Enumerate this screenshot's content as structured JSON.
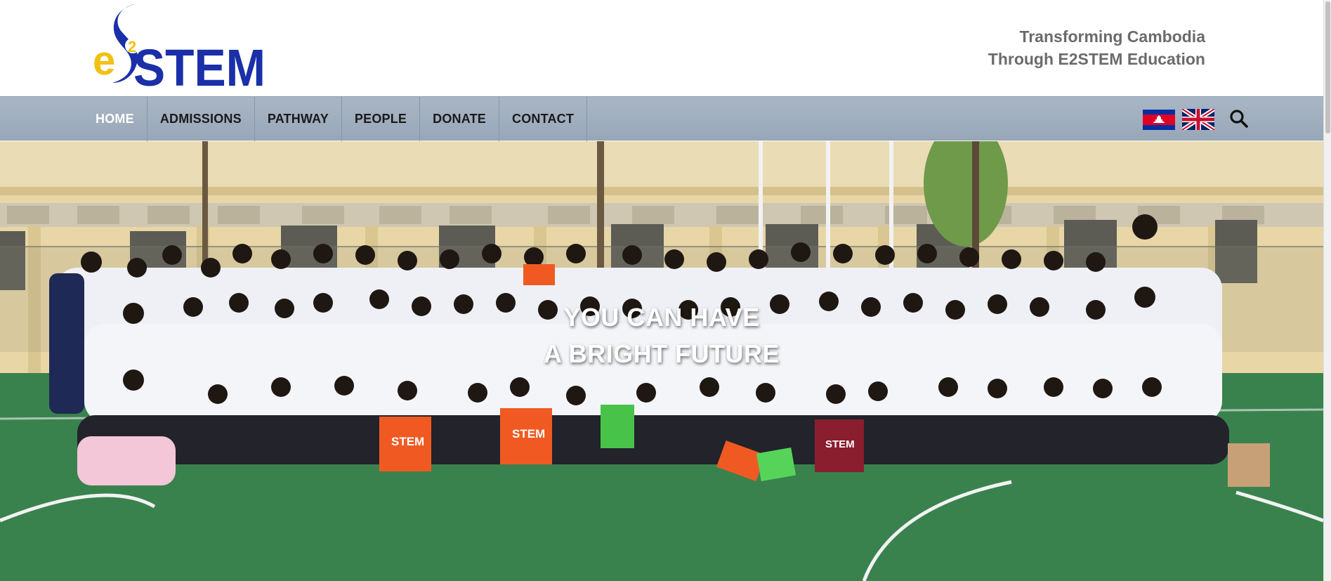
{
  "logo": {
    "text_e": "e",
    "text_2": "2",
    "text_stem": "STEM",
    "colors": {
      "yellow": "#f2c010",
      "blue": "#1a2fa8"
    }
  },
  "tagline": {
    "line1": "Transforming Cambodia",
    "line2": "Through E2STEM Education"
  },
  "nav": {
    "items": [
      {
        "label": "HOME",
        "active": true
      },
      {
        "label": "ADMISSIONS",
        "active": false
      },
      {
        "label": "PATHWAY",
        "active": false
      },
      {
        "label": "PEOPLE",
        "active": false
      },
      {
        "label": "DONATE",
        "active": false
      },
      {
        "label": "CONTACT",
        "active": false
      }
    ],
    "languages": [
      "cambodia-flag-icon",
      "uk-flag-icon"
    ],
    "search_icon": "search-icon"
  },
  "hero": {
    "line1": "YOU CAN HAVE",
    "line2": "A BRIGHT FUTURE",
    "image": "group-photo-students"
  },
  "colors": {
    "nav_bg": "#a3b1c1",
    "active": "#ffffff",
    "text": "#1a1a1a",
    "tagline": "#6b6b6b"
  }
}
